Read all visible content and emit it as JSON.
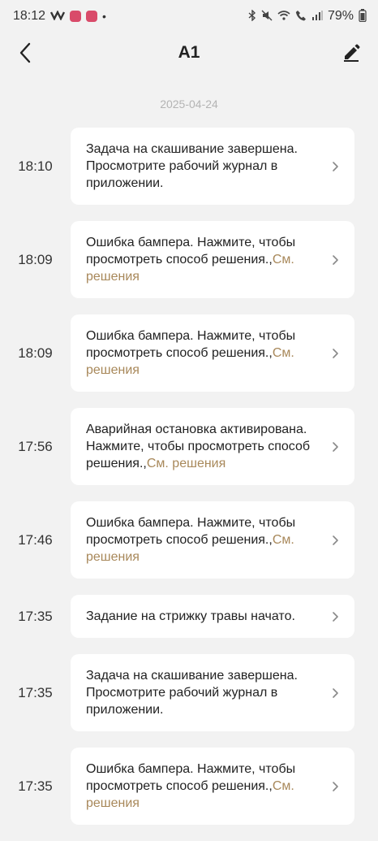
{
  "status_bar": {
    "time": "18:12",
    "dot": "•",
    "battery": "79%"
  },
  "header": {
    "title": "A1"
  },
  "date_label": "2025-04-24",
  "messages": [
    {
      "time": "18:10",
      "text": "Задача на скашивание завершена. Просмотрите рабочий журнал в приложении.",
      "link": ""
    },
    {
      "time": "18:09",
      "text": "Ошибка бампера. Нажмите, чтобы просмотреть способ решения.,",
      "link": "См. решения"
    },
    {
      "time": "18:09",
      "text": "Ошибка бампера. Нажмите, чтобы просмотреть способ решения.,",
      "link": "См. решения"
    },
    {
      "time": "17:56",
      "text": "Аварийная остановка активирована. Нажмите, чтобы просмотреть способ решения.,",
      "link": "См. решения"
    },
    {
      "time": "17:46",
      "text": "Ошибка бампера. Нажмите, чтобы просмотреть способ решения.,",
      "link": "См. решения"
    },
    {
      "time": "17:35",
      "text": "Задание на стрижку травы начато.",
      "link": ""
    },
    {
      "time": "17:35",
      "text": "Задача на скашивание завершена. Просмотрите рабочий журнал в приложении.",
      "link": ""
    },
    {
      "time": "17:35",
      "text": "Ошибка бампера. Нажмите, чтобы просмотреть способ решения.,",
      "link": "См. решения"
    }
  ]
}
